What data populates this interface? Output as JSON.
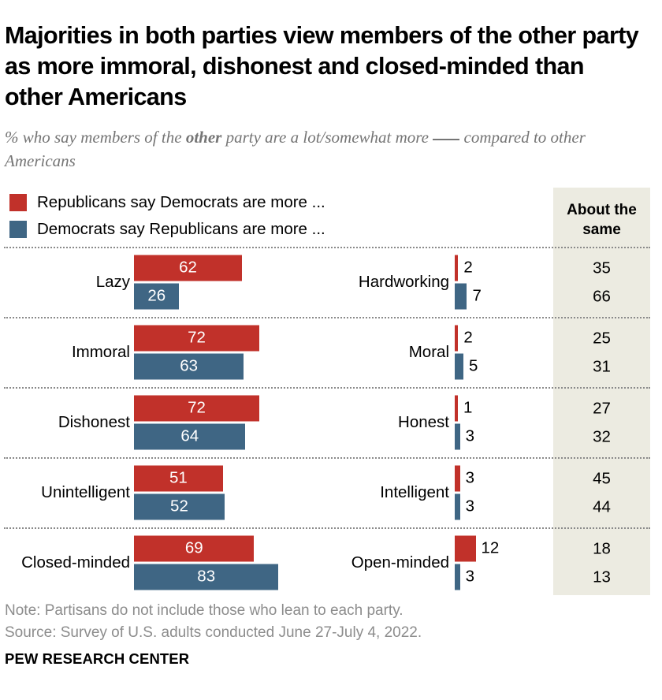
{
  "title": "Majorities in both parties view members of the other party as more immoral, dishonest and closed-minded than other Americans",
  "subtitle": {
    "part1": "% who say members of the ",
    "emphasis": "other",
    "part2": " party are a lot/somewhat more ",
    "part3": "compared to other Americans"
  },
  "legend": {
    "items": [
      {
        "label": "Republicans say Democrats are more ...",
        "color": "#c1312a",
        "key": "republicans"
      },
      {
        "label": "Democrats say Republicans are more ...",
        "color": "#3f6684",
        "key": "democrats"
      }
    ]
  },
  "same_column": {
    "header_line1": "About the",
    "header_line2": "same",
    "background": "#ecebe1"
  },
  "notes": {
    "note": "Note: Partisans do not include those who lean to each party.",
    "source": "Source: Survey of U.S. adults conducted June 27-July 4, 2022."
  },
  "brand": "PEW RESEARCH CENTER",
  "chart_data": {
    "type": "bar",
    "title": "Majorities in both parties view members of the other party as more immoral, dishonest and closed-minded than other Americans",
    "subtitle": "% who say members of the other party are a lot/somewhat more ___ compared to other Americans",
    "orientation": "horizontal",
    "grid": false,
    "legend_position": "top-left",
    "xlim": [
      0,
      100
    ],
    "xlabel": "",
    "ylabel": "",
    "series": [
      {
        "name": "Republicans say Democrats are more ...",
        "color": "#c1312a"
      },
      {
        "name": "Democrats say Republicans are more ...",
        "color": "#3f6684"
      }
    ],
    "rows": [
      {
        "negative_trait": "Lazy",
        "positive_trait": "Hardworking",
        "negative": {
          "republicans": 62,
          "democrats": 26
        },
        "positive": {
          "republicans": 2,
          "democrats": 7
        },
        "about_the_same": {
          "republicans": 35,
          "democrats": 66
        }
      },
      {
        "negative_trait": "Immoral",
        "positive_trait": "Moral",
        "negative": {
          "republicans": 72,
          "democrats": 63
        },
        "positive": {
          "republicans": 2,
          "democrats": 5
        },
        "about_the_same": {
          "republicans": 25,
          "democrats": 31
        }
      },
      {
        "negative_trait": "Dishonest",
        "positive_trait": "Honest",
        "negative": {
          "republicans": 72,
          "democrats": 64
        },
        "positive": {
          "republicans": 1,
          "democrats": 3
        },
        "about_the_same": {
          "republicans": 27,
          "democrats": 32
        }
      },
      {
        "negative_trait": "Unintelligent",
        "positive_trait": "Intelligent",
        "negative": {
          "republicans": 51,
          "democrats": 52
        },
        "positive": {
          "republicans": 3,
          "democrats": 3
        },
        "about_the_same": {
          "republicans": 45,
          "democrats": 44
        }
      },
      {
        "negative_trait": "Closed-minded",
        "positive_trait": "Open-minded",
        "negative": {
          "republicans": 69,
          "democrats": 83
        },
        "positive": {
          "republicans": 12,
          "democrats": 3
        },
        "about_the_same": {
          "republicans": 18,
          "democrats": 13
        }
      }
    ]
  }
}
